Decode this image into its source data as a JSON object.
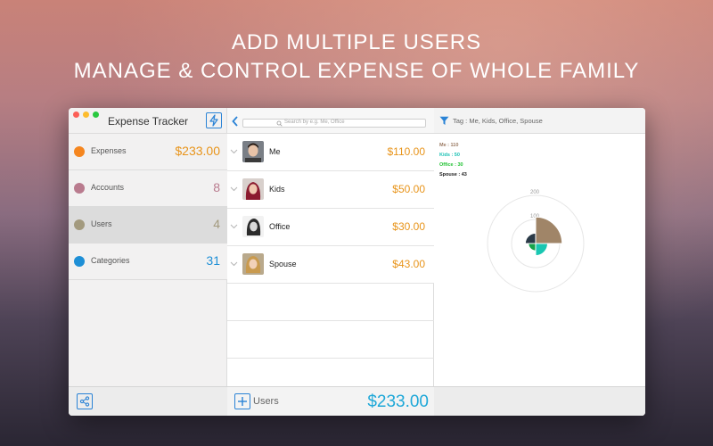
{
  "headline": {
    "line1": "ADD MULTIPLE USERS",
    "line2": "MANAGE & CONTROL EXPENSE OF WHOLE FAMILY"
  },
  "app": {
    "title": "Expense Tracker",
    "title_button_icon": "bolt-icon"
  },
  "sidebar": {
    "items": [
      {
        "label": "Expenses",
        "value": "$233.00",
        "dot_color": "#f5861f",
        "value_color": "#e8941a"
      },
      {
        "label": "Accounts",
        "value": "8",
        "dot_color": "#b97b8e",
        "value_color": "#b97b8e"
      },
      {
        "label": "Users",
        "value": "4",
        "dot_color": "#a39a7e",
        "value_color": "#a39a7e",
        "active": true
      },
      {
        "label": "Categories",
        "value": "31",
        "dot_color": "#1e8fd6",
        "value_color": "#1e8fd6"
      }
    ],
    "footer_icon": "share-icon"
  },
  "list": {
    "search_placeholder": "Search by e.g. Me, Office",
    "users": [
      {
        "name": "Me",
        "amount": "$110.00",
        "avatar": "portrait-man-icon"
      },
      {
        "name": "Kids",
        "amount": "$50.00",
        "avatar": "portrait-girl-icon"
      },
      {
        "name": "Office",
        "amount": "$30.00",
        "avatar": "portrait-woman-icon"
      },
      {
        "name": "Spouse",
        "amount": "$43.00",
        "avatar": "portrait-woman-blonde-icon"
      }
    ],
    "footer_label": "Users",
    "footer_total": "$233.00"
  },
  "panel": {
    "tag_text": "Tag : Me, Kids, Office, Spouse",
    "legend": [
      {
        "text": "Me : 110",
        "color": "#9b7a63"
      },
      {
        "text": "Kids : 50",
        "color": "#19c0b4"
      },
      {
        "text": "Office : 30",
        "color": "#22c233"
      },
      {
        "text": "Spouse : 43",
        "color": "#222222"
      }
    ]
  },
  "chart_data": {
    "type": "pie",
    "subtype": "polar-area",
    "categories": [
      "Me",
      "Kids",
      "Office",
      "Spouse"
    ],
    "values": [
      110,
      50,
      30,
      43
    ],
    "colors": [
      "#a08568",
      "#19c7b2",
      "#16a34a",
      "#2b3a47"
    ],
    "radial_ticks": [
      "100",
      "200"
    ],
    "rlim": [
      0,
      200
    ]
  }
}
